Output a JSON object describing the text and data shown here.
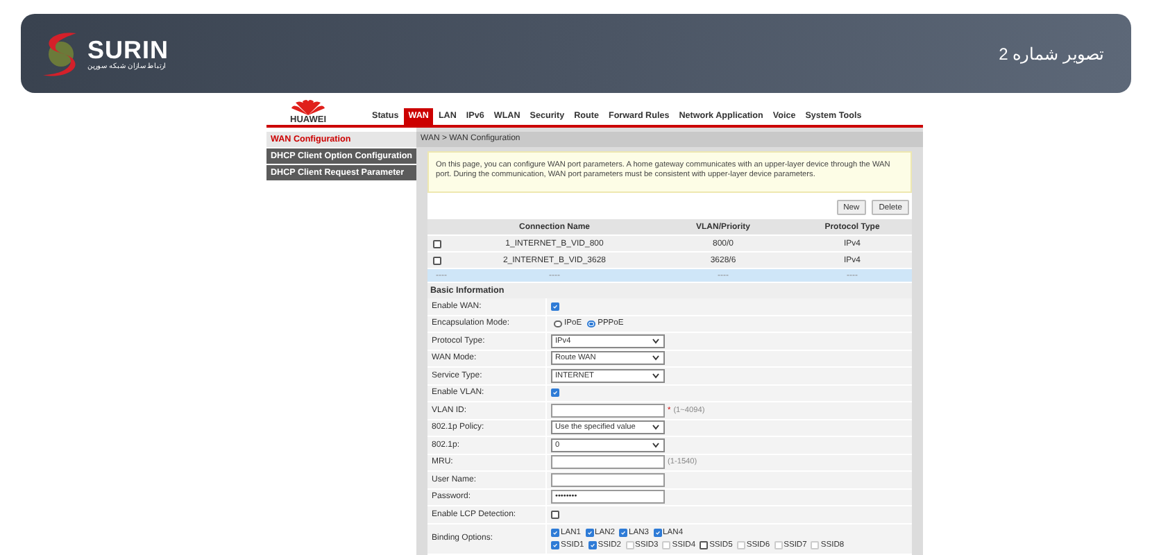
{
  "banner": {
    "brand": "SURIN",
    "tagline": "ارتباط سازان شبکه سورین",
    "caption": "تصویر شماره 2"
  },
  "router": {
    "logo_text": "HUAWEI",
    "tabs": [
      {
        "label": "Status",
        "selected": false
      },
      {
        "label": "WAN",
        "selected": true
      },
      {
        "label": "LAN",
        "selected": false
      },
      {
        "label": "IPv6",
        "selected": false
      },
      {
        "label": "WLAN",
        "selected": false
      },
      {
        "label": "Security",
        "selected": false
      },
      {
        "label": "Route",
        "selected": false
      },
      {
        "label": "Forward Rules",
        "selected": false
      },
      {
        "label": "Network Application",
        "selected": false
      },
      {
        "label": "Voice",
        "selected": false
      },
      {
        "label": "System Tools",
        "selected": false
      }
    ],
    "sidebar": [
      {
        "label": "WAN Configuration",
        "selected": true
      },
      {
        "label": "DHCP Client Option Configuration",
        "selected": false
      },
      {
        "label": "DHCP Client Request Parameter",
        "selected": false
      }
    ],
    "breadcrumb": "WAN > WAN Configuration",
    "notice": "On this page, you can configure WAN port parameters. A home gateway communicates with an upper-layer device through the WAN port. During the communication, WAN port parameters must be consistent with upper-layer device parameters.",
    "buttons": [
      "New",
      "Delete"
    ],
    "table": {
      "columns": [
        "Connection Name",
        "VLAN/Priority",
        "Protocol Type"
      ],
      "rows": [
        {
          "checked": false,
          "cells": [
            "1_INTERNET_B_VID_800",
            "800/0",
            "IPv4"
          ]
        },
        {
          "checked": false,
          "cells": [
            "2_INTERNET_B_VID_3628",
            "3628/6",
            "IPv4"
          ]
        }
      ],
      "blank_row": [
        "----",
        "----",
        "----",
        "----"
      ]
    },
    "section": "Basic Information",
    "form": [
      {
        "kind": "checkbox",
        "label": "Enable WAN:",
        "checked": true
      },
      {
        "kind": "radio",
        "label": "Encapsulation Mode:",
        "options": [
          {
            "label": "IPoE",
            "selected": false
          },
          {
            "label": "PPPoE",
            "selected": true
          }
        ]
      },
      {
        "kind": "select",
        "label": "Protocol Type:",
        "value": "IPv4"
      },
      {
        "kind": "select",
        "label": "WAN Mode:",
        "value": "Route WAN"
      },
      {
        "kind": "select",
        "label": "Service Type:",
        "value": "INTERNET"
      },
      {
        "kind": "checkbox",
        "label": "Enable VLAN:",
        "checked": true
      },
      {
        "kind": "input",
        "label": "VLAN ID:",
        "mark": "*",
        "hint": "(1~4094)"
      },
      {
        "kind": "select",
        "label": "802.1p Policy:",
        "value": "Use the specified value"
      },
      {
        "kind": "select",
        "label": "802.1p:",
        "value": "0"
      },
      {
        "kind": "input",
        "label": "MRU:",
        "hint": "(1-1540)"
      },
      {
        "kind": "input",
        "label": "User Name:"
      },
      {
        "kind": "input",
        "label": "Password:",
        "value": "••••••••"
      },
      {
        "kind": "checkbox",
        "label": "Enable LCP Detection:",
        "checked": false
      },
      {
        "kind": "bindings",
        "label": "Binding Options:",
        "groups": [
          [
            {
              "label": "LAN1",
              "checked": true,
              "disabled": false
            },
            {
              "label": "LAN2",
              "checked": true,
              "disabled": false
            },
            {
              "label": "LAN3",
              "checked": true,
              "disabled": false
            },
            {
              "label": "LAN4",
              "checked": true,
              "disabled": false
            }
          ],
          [
            {
              "label": "SSID1",
              "checked": true,
              "disabled": false
            },
            {
              "label": "SSID2",
              "checked": true,
              "disabled": false
            },
            {
              "label": "SSID3",
              "checked": false,
              "disabled": true
            },
            {
              "label": "SSID4",
              "checked": false,
              "disabled": true
            },
            {
              "label": "SSID5",
              "checked": false,
              "disabled": false
            },
            {
              "label": "SSID6",
              "checked": false,
              "disabled": true
            },
            {
              "label": "SSID7",
              "checked": false,
              "disabled": true
            },
            {
              "label": "SSID8",
              "checked": false,
              "disabled": true
            }
          ]
        ]
      }
    ]
  }
}
